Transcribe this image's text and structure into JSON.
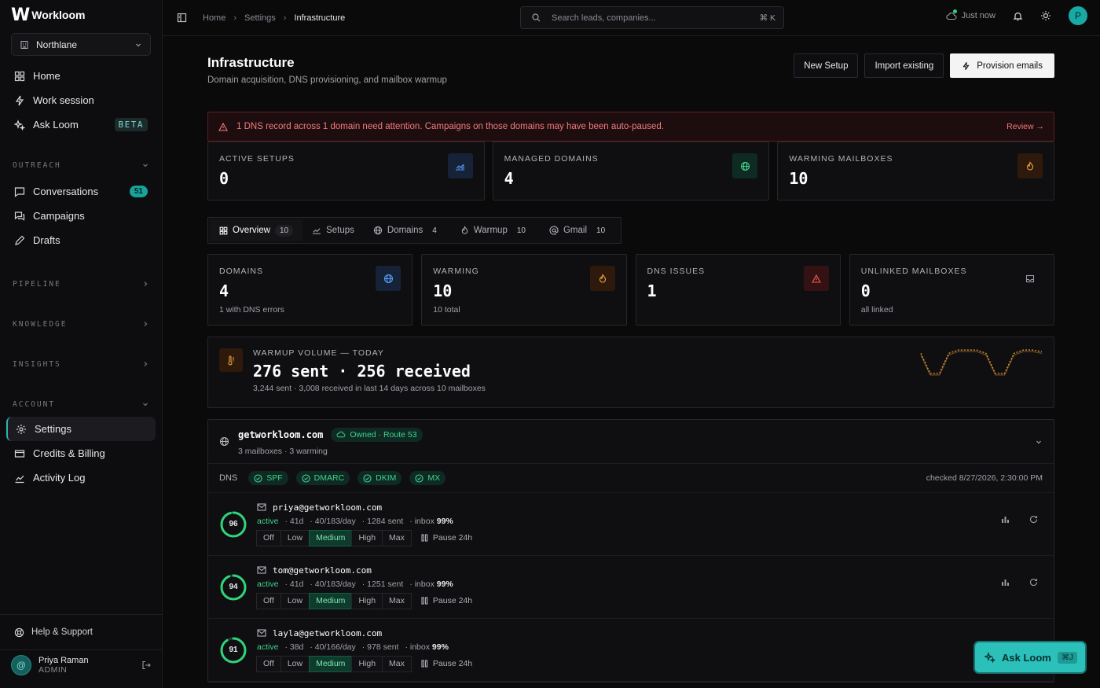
{
  "app": {
    "logo_mark": "W",
    "logo_text": "Workloom"
  },
  "workspace": {
    "name": "Northlane"
  },
  "sidebar": {
    "primary": [
      {
        "label": "Home"
      },
      {
        "label": "Work session"
      },
      {
        "label": "Ask Loom",
        "badge": "BETA"
      }
    ],
    "outreach_title": "OUTREACH",
    "outreach": [
      {
        "label": "Conversations",
        "count": "51"
      },
      {
        "label": "Campaigns"
      },
      {
        "label": "Drafts"
      }
    ],
    "pipeline_title": "PIPELINE",
    "knowledge_title": "KNOWLEDGE",
    "insights_title": "INSIGHTS",
    "account_title": "ACCOUNT",
    "account": [
      {
        "label": "Settings"
      },
      {
        "label": "Credits & Billing"
      },
      {
        "label": "Activity Log"
      }
    ],
    "help": "Help & Support",
    "user": {
      "name": "Priya Raman",
      "role": "ADMIN",
      "initial": "@"
    }
  },
  "topbar": {
    "breadcrumb": [
      "Home",
      "Settings",
      "Infrastructure"
    ],
    "search_placeholder": "Search leads, companies...",
    "search_shortcut": "⌘ K",
    "sync_status": "Just now",
    "avatar_initial": "P"
  },
  "page": {
    "title": "Infrastructure",
    "subtitle": "Domain acquisition, DNS provisioning, and mailbox warmup",
    "actions": {
      "new_setup": "New Setup",
      "import": "Import existing",
      "provision": "Provision emails"
    }
  },
  "alert": {
    "message": "1 DNS record across 1 domain need attention. Campaigns on those domains may have been auto-paused.",
    "action": "Review →"
  },
  "top_stats": [
    {
      "label": "ACTIVE SETUPS",
      "value": "0",
      "icon": "chart-icon",
      "color": "blue"
    },
    {
      "label": "MANAGED DOMAINS",
      "value": "4",
      "icon": "globe-icon",
      "color": "green"
    },
    {
      "label": "WARMING MAILBOXES",
      "value": "10",
      "icon": "flame-icon",
      "color": "orange"
    }
  ],
  "tabs": [
    {
      "label": "Overview",
      "count": "10"
    },
    {
      "label": "Setups",
      "count": ""
    },
    {
      "label": "Domains",
      "count": "4"
    },
    {
      "label": "Warmup",
      "count": "10"
    },
    {
      "label": "Gmail",
      "count": "10"
    }
  ],
  "overview_stats": [
    {
      "label": "DOMAINS",
      "value": "4",
      "sub": "1 with DNS errors"
    },
    {
      "label": "WARMING",
      "value": "10",
      "sub": "10 total"
    },
    {
      "label": "DNS ISSUES",
      "value": "1",
      "sub": ""
    },
    {
      "label": "UNLINKED MAILBOXES",
      "value": "0",
      "sub": "all linked"
    }
  ],
  "warmup": {
    "label": "WARMUP VOLUME — TODAY",
    "headline": "276 sent · 256 received",
    "sub": "3,244 sent · 3,008 received in last 14 days across 10 mailboxes",
    "sparkline": {
      "sent": [
        246,
        222,
        222,
        246,
        250,
        250,
        250,
        246,
        222,
        222,
        246,
        250,
        250,
        248
      ],
      "received": [
        244,
        220,
        220,
        244,
        248,
        248,
        248,
        244,
        220,
        220,
        244,
        248,
        248,
        246
      ]
    }
  },
  "domain": {
    "name": "getworkloom.com",
    "tag": "Owned · Route 53",
    "sub": "3 mailboxes · 3 warming",
    "dns_label": "DNS",
    "dns_records": [
      "SPF",
      "DMARC",
      "DKIM",
      "MX"
    ],
    "checked": "checked 8/27/2026, 2:30:00 PM",
    "mailboxes": [
      {
        "score": 96,
        "email": "priya@getworkloom.com",
        "status": "active",
        "age": "· 41d",
        "rate": "· 40/183/day",
        "sent": "· 1284 sent",
        "inbox_label": "· inbox",
        "inbox": "99%",
        "level": "Medium"
      },
      {
        "score": 94,
        "email": "tom@getworkloom.com",
        "status": "active",
        "age": "· 41d",
        "rate": "· 40/183/day",
        "sent": "· 1251 sent",
        "inbox_label": "· inbox",
        "inbox": "99%",
        "level": "Medium"
      },
      {
        "score": 91,
        "email": "layla@getworkloom.com",
        "status": "active",
        "age": "· 38d",
        "rate": "· 40/166/day",
        "sent": "· 978 sent",
        "inbox_label": "· inbox",
        "inbox": "99%",
        "level": "Medium"
      }
    ],
    "levels": [
      "Off",
      "Low",
      "Medium",
      "High",
      "Max"
    ],
    "pause_label": "Pause 24h"
  },
  "fab": {
    "label": "Ask Loom",
    "shortcut": "⌘J"
  },
  "colors": {
    "accent": "#2bc0ba",
    "success": "#3ed38e",
    "danger": "#f07b7b",
    "warning": "#f0a43e"
  }
}
